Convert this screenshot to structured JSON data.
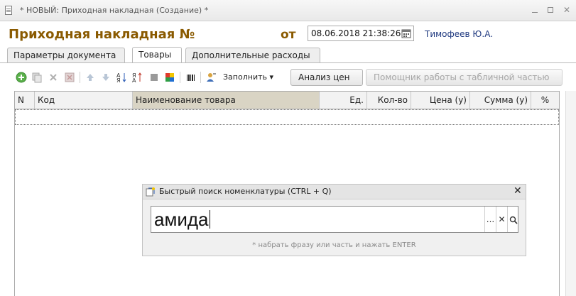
{
  "window": {
    "title": "* НОВЫЙ: Приходная накладная (Создание) *"
  },
  "header": {
    "doc_title": "Приходная накладная №",
    "date_label": "от",
    "date_value": "08.06.2018 21:38:26",
    "author": "Тимофеев Ю.А."
  },
  "tabs": [
    {
      "label": "Параметры документа",
      "active": false
    },
    {
      "label": "Товары",
      "active": true
    },
    {
      "label": "Дополнительные расходы",
      "active": false
    }
  ],
  "toolbar": {
    "fill_label": "Заполнить",
    "price_analysis_label": "Анализ цен",
    "table_helper_label": "Помощник работы с табличной частью"
  },
  "grid": {
    "columns": [
      "N",
      "Код",
      "Наименование товара",
      "Ед.",
      "Кол-во",
      "Цена (у)",
      "Сумма (у)",
      "%"
    ],
    "rows": []
  },
  "quick_search": {
    "title": "Быстрый поиск номенклатуры (CTRL + Q)",
    "value": "амида",
    "hint": "* набрать фразу или часть и нажать ENTER",
    "select_btn": "...",
    "clear_btn": "✕",
    "search_btn": "search"
  },
  "icons": [
    "document-icon",
    "add-icon",
    "copy-icon",
    "delete-icon",
    "mark-delete-icon",
    "move-up-icon",
    "move-down-icon",
    "sort-asc-icon",
    "sort-desc-icon",
    "gray-square-icon",
    "color-blocks-icon",
    "barcode-icon",
    "user-select-icon",
    "calendar-icon",
    "quick-search-icon"
  ],
  "colors": {
    "title_brown": "#8a5a00",
    "author_blue": "#203a80",
    "sorted_col": "#d9d4c4"
  }
}
